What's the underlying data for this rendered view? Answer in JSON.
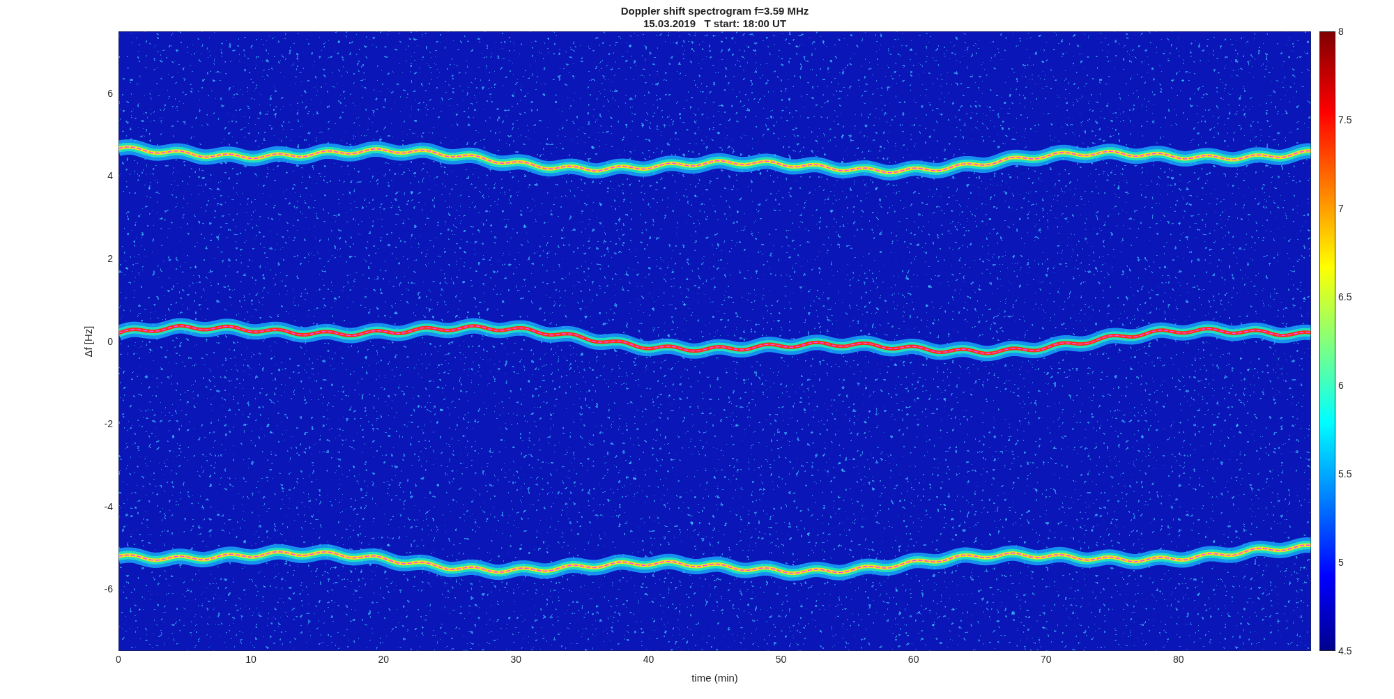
{
  "figure": {
    "title_lines": [
      "Doppler shift spectrogram f=3.59 MHz",
      "15.03.2019   T start: 18:00 UT"
    ],
    "ylabel": "Δf [Hz]",
    "xlabel": "time (min)",
    "yticks": [
      "6",
      "4",
      "2",
      "0",
      "-2",
      "-4",
      "-6"
    ],
    "xticks": [
      "0",
      "10",
      "20",
      "30",
      "40",
      "50",
      "60",
      "70",
      "80"
    ],
    "colorbar_ticks": [
      "8",
      "7.5",
      "7",
      "6.5",
      "6",
      "5.5",
      "5",
      "4.5"
    ]
  }
}
